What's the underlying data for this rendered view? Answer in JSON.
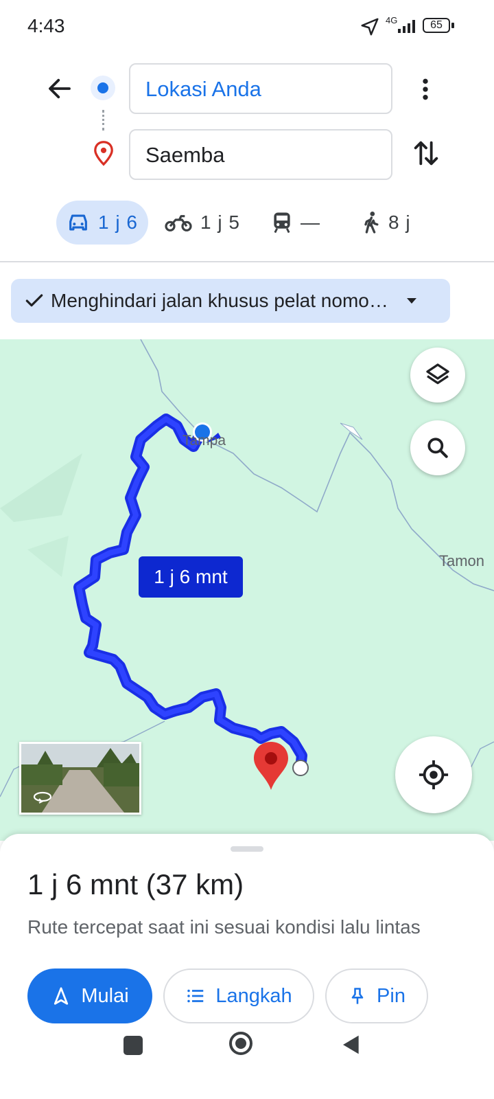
{
  "status_bar": {
    "time": "4:43",
    "network": "4G",
    "battery": "65"
  },
  "directions": {
    "origin": "Lokasi Anda",
    "destination": "Saemba"
  },
  "modes": [
    {
      "icon": "car-icon",
      "label": "1 j 6",
      "selected": true
    },
    {
      "icon": "motorcycle-icon",
      "label": "1 j 5",
      "selected": false
    },
    {
      "icon": "transit-icon",
      "label": "—",
      "selected": false
    },
    {
      "icon": "walk-icon",
      "label": "8 j",
      "selected": false
    }
  ],
  "option_chip": {
    "label": "Menghindari jalan khusus pelat nomo…"
  },
  "map": {
    "place_labels": [
      "Tampa",
      "Tamon"
    ],
    "route_eta_label": "1 j 6 mnt",
    "colors": {
      "route": "#1a2fe6",
      "route_label": "#0d28d0",
      "map_bg": "#d1f5e2",
      "destination_pin": "#e53935"
    }
  },
  "sheet": {
    "summary": "1 j 6 mnt (37 km)",
    "subtitle": "Rute tercepat saat ini sesuai kondisi lalu lintas",
    "buttons": {
      "start": "Mulai",
      "steps": "Langkah",
      "pin": "Pin"
    }
  },
  "accent_color": "#1a73e8"
}
